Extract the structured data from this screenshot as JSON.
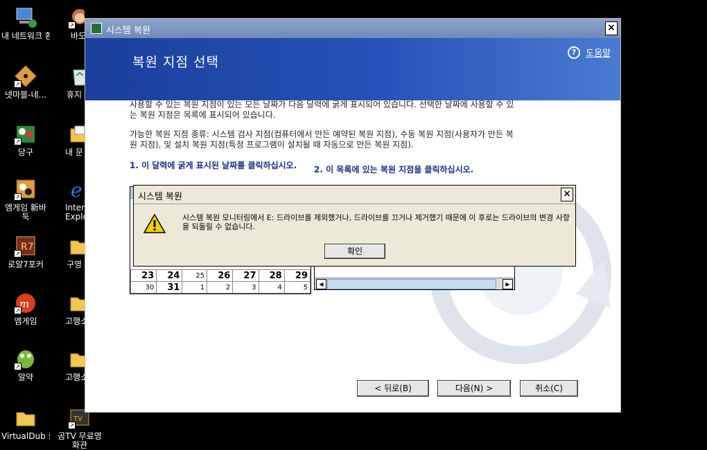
{
  "desktop": {
    "left_icons": [
      "내 네트워크 환경",
      "넷마블-네...",
      "당구",
      "엠게임 新바둑",
      "로얄7포커",
      "엠게임",
      "알약",
      "VirtualDub 를"
    ],
    "right_icons": [
      "바도",
      "휴지",
      "내 문",
      "Intern Explo",
      "구영",
      "고행소",
      "고행소",
      "곰TV 무료영화관"
    ]
  },
  "window": {
    "title": "시스템 복원",
    "close": "×",
    "header": "복원 지점 선택",
    "help_icon": "?",
    "help": "도움말",
    "para1": "사용할 수 있는 복원 지점이 있는 모든 날짜가 다음 달력에 굵게 표시되어 있습니다. 선택한 날짜에 사용할 수 있는 복원 지점은 목록에 표시되어 있습니다.",
    "para2": "가능한 복원 지점 종류: 시스템 검사 지점(컴퓨터에서 만든 예약된 복원 지점), 수동 복원 지점(사용자가 만든 복원 지점), 및 설치 복원 지점(특정 프로그램이 설치될 때 자동으로 만든 복원 지점).",
    "step1": "1. 이 달력에 굵게 표시된 날짜를 클릭하십시오.",
    "step2": "2. 이 목록에 있는 복원 지점을 클릭하십시오.",
    "calendar_rows": [
      [
        {
          "d": "23",
          "b": true
        },
        {
          "d": "24",
          "b": true
        },
        {
          "d": "25",
          "b": false
        },
        {
          "d": "26",
          "b": true
        },
        {
          "d": "27",
          "b": true
        },
        {
          "d": "28",
          "b": true
        },
        {
          "d": "29",
          "b": true
        }
      ],
      [
        {
          "d": "30",
          "b": false
        },
        {
          "d": "31",
          "b": true
        },
        {
          "d": "1",
          "b": false
        },
        {
          "d": "2",
          "b": false
        },
        {
          "d": "3",
          "b": false
        },
        {
          "d": "4",
          "b": false
        },
        {
          "d": "5",
          "b": false
        }
      ]
    ],
    "scroll_left": "◀",
    "scroll_right": "▶",
    "back": "< 뒤로(B)",
    "next": "다음(N) >",
    "cancel": "취소(C)"
  },
  "dialog": {
    "title": "시스템 복원",
    "close": "×",
    "message": "시스템 복원 모니터링에서 E: 드라이브를 제외했거나, 드라이브를 끄거나 제거했기 때문에 이 후로는 드라이브의 변경 사항을 되돌릴 수 없습니다.",
    "ok": "확인"
  }
}
